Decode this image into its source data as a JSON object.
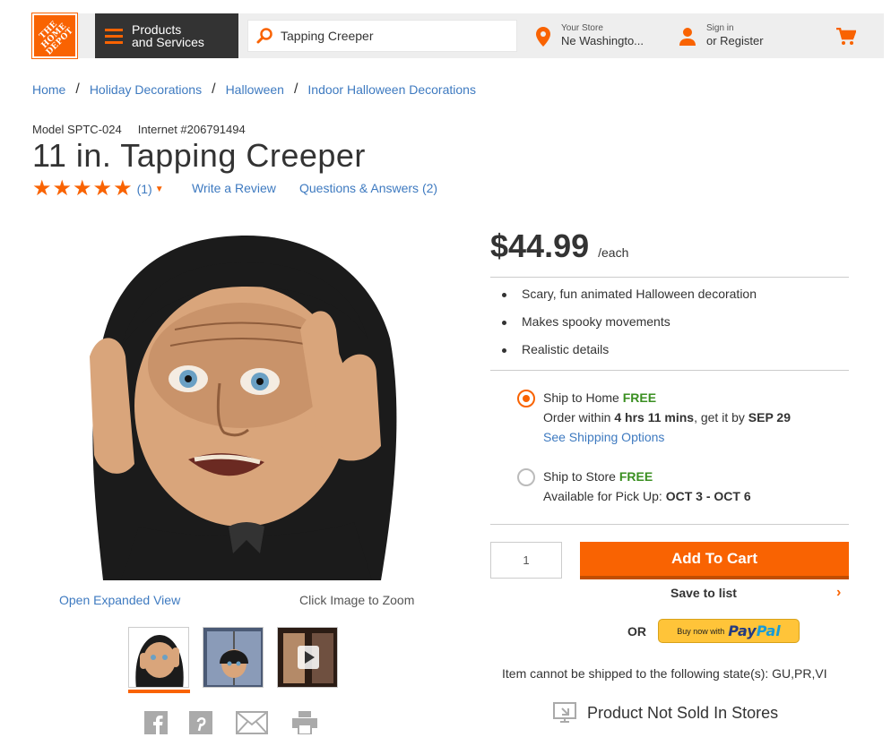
{
  "header": {
    "logo_text": "THE HOME DEPOT",
    "products_label_1": "Products",
    "products_label_2": "and Services",
    "search_value": "Tapping Creeper",
    "store_label": "Your Store",
    "store_name": "Ne Washingto...",
    "signin_label": "Sign in",
    "register_label": "or Register"
  },
  "breadcrumbs": [
    "Home",
    "Holiday Decorations",
    "Halloween",
    "Indoor Halloween Decorations"
  ],
  "product": {
    "model": "Model SPTC-024",
    "internet": "Internet #206791494",
    "title": "11 in. Tapping Creeper",
    "rating_stars": 5,
    "rating_count": "(1)",
    "write_review": "Write a Review",
    "qa": "Questions & Answers (2)",
    "open_expanded": "Open Expanded View",
    "click_zoom": "Click Image to Zoom"
  },
  "pricing": {
    "price": "$44.99",
    "unit": "/each"
  },
  "bullets": [
    "Scary, fun animated Halloween decoration",
    "Makes spooky movements",
    "Realistic details"
  ],
  "shipping": {
    "home_label": "Ship to Home",
    "home_free": "FREE",
    "order_within": "Order within",
    "hours": "4 hrs 11 mins",
    "get_it_by": ", get it by",
    "date": "SEP 29",
    "options_link": "See Shipping Options",
    "store_label": "Ship to Store",
    "store_free": "FREE",
    "pickup_label": "Available for Pick Up:",
    "pickup_dates": "OCT 3 - OCT 6"
  },
  "cart": {
    "qty": "1",
    "add_label": "Add To Cart",
    "save_label": "Save to list",
    "or": "OR",
    "paypal_buy": "Buy now with",
    "paypal_pay": "Pay",
    "paypal_pal": "Pal"
  },
  "notices": {
    "no_ship": "Item cannot be shipped to the following state(s): GU,PR,VI",
    "not_sold": "Product Not Sold In Stores"
  },
  "colors": {
    "brand_orange": "#f96302",
    "link_blue": "#3e7ac0",
    "free_green": "#3a8f21"
  }
}
